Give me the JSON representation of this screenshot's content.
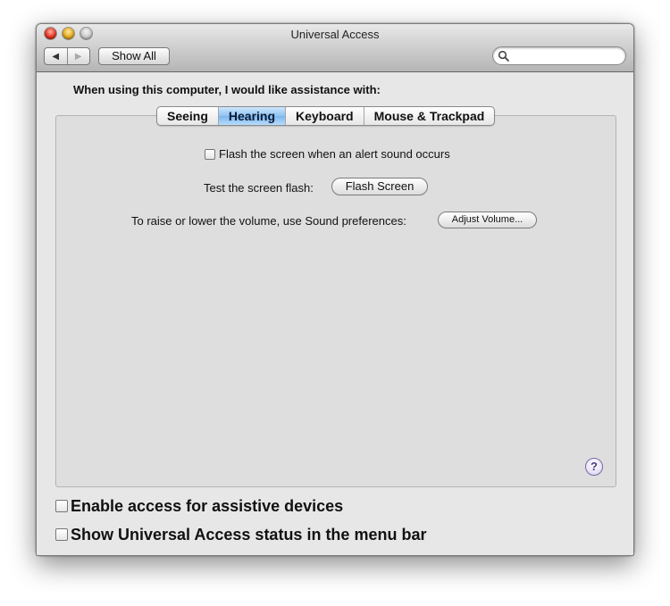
{
  "window": {
    "title": "Universal Access",
    "toolbar": {
      "back_icon": "◀",
      "forward_icon": "▶",
      "show_all_label": "Show All",
      "search_value": "",
      "search_placeholder": ""
    }
  },
  "prompt": "When using this computer, I would like assistance with:",
  "tabs": [
    {
      "label": "Seeing",
      "active": false
    },
    {
      "label": "Hearing",
      "active": true
    },
    {
      "label": "Keyboard",
      "active": false
    },
    {
      "label": "Mouse & Trackpad",
      "active": false
    }
  ],
  "hearing": {
    "flash_checkbox_label": "Flash the screen when an alert sound occurs",
    "flash_checked": false,
    "test_label": "Test the screen flash:",
    "flash_button_label": "Flash Screen",
    "volume_label": "To raise or lower the volume, use Sound preferences:",
    "adjust_volume_label": "Adjust Volume..."
  },
  "help_label": "?",
  "footer": {
    "assistive_label": "Enable access for assistive devices",
    "assistive_checked": false,
    "status_label": "Show Universal Access status in the menu bar",
    "status_checked": false
  },
  "colors": {
    "active_tab": "#8fc3f2",
    "window_bg": "#e7e7e7",
    "panel_bg": "#dedede"
  },
  "icons": {
    "close": "close-icon",
    "minimize": "minimize-icon",
    "zoom": "zoom-icon",
    "search": "search-icon",
    "help": "help-icon"
  }
}
